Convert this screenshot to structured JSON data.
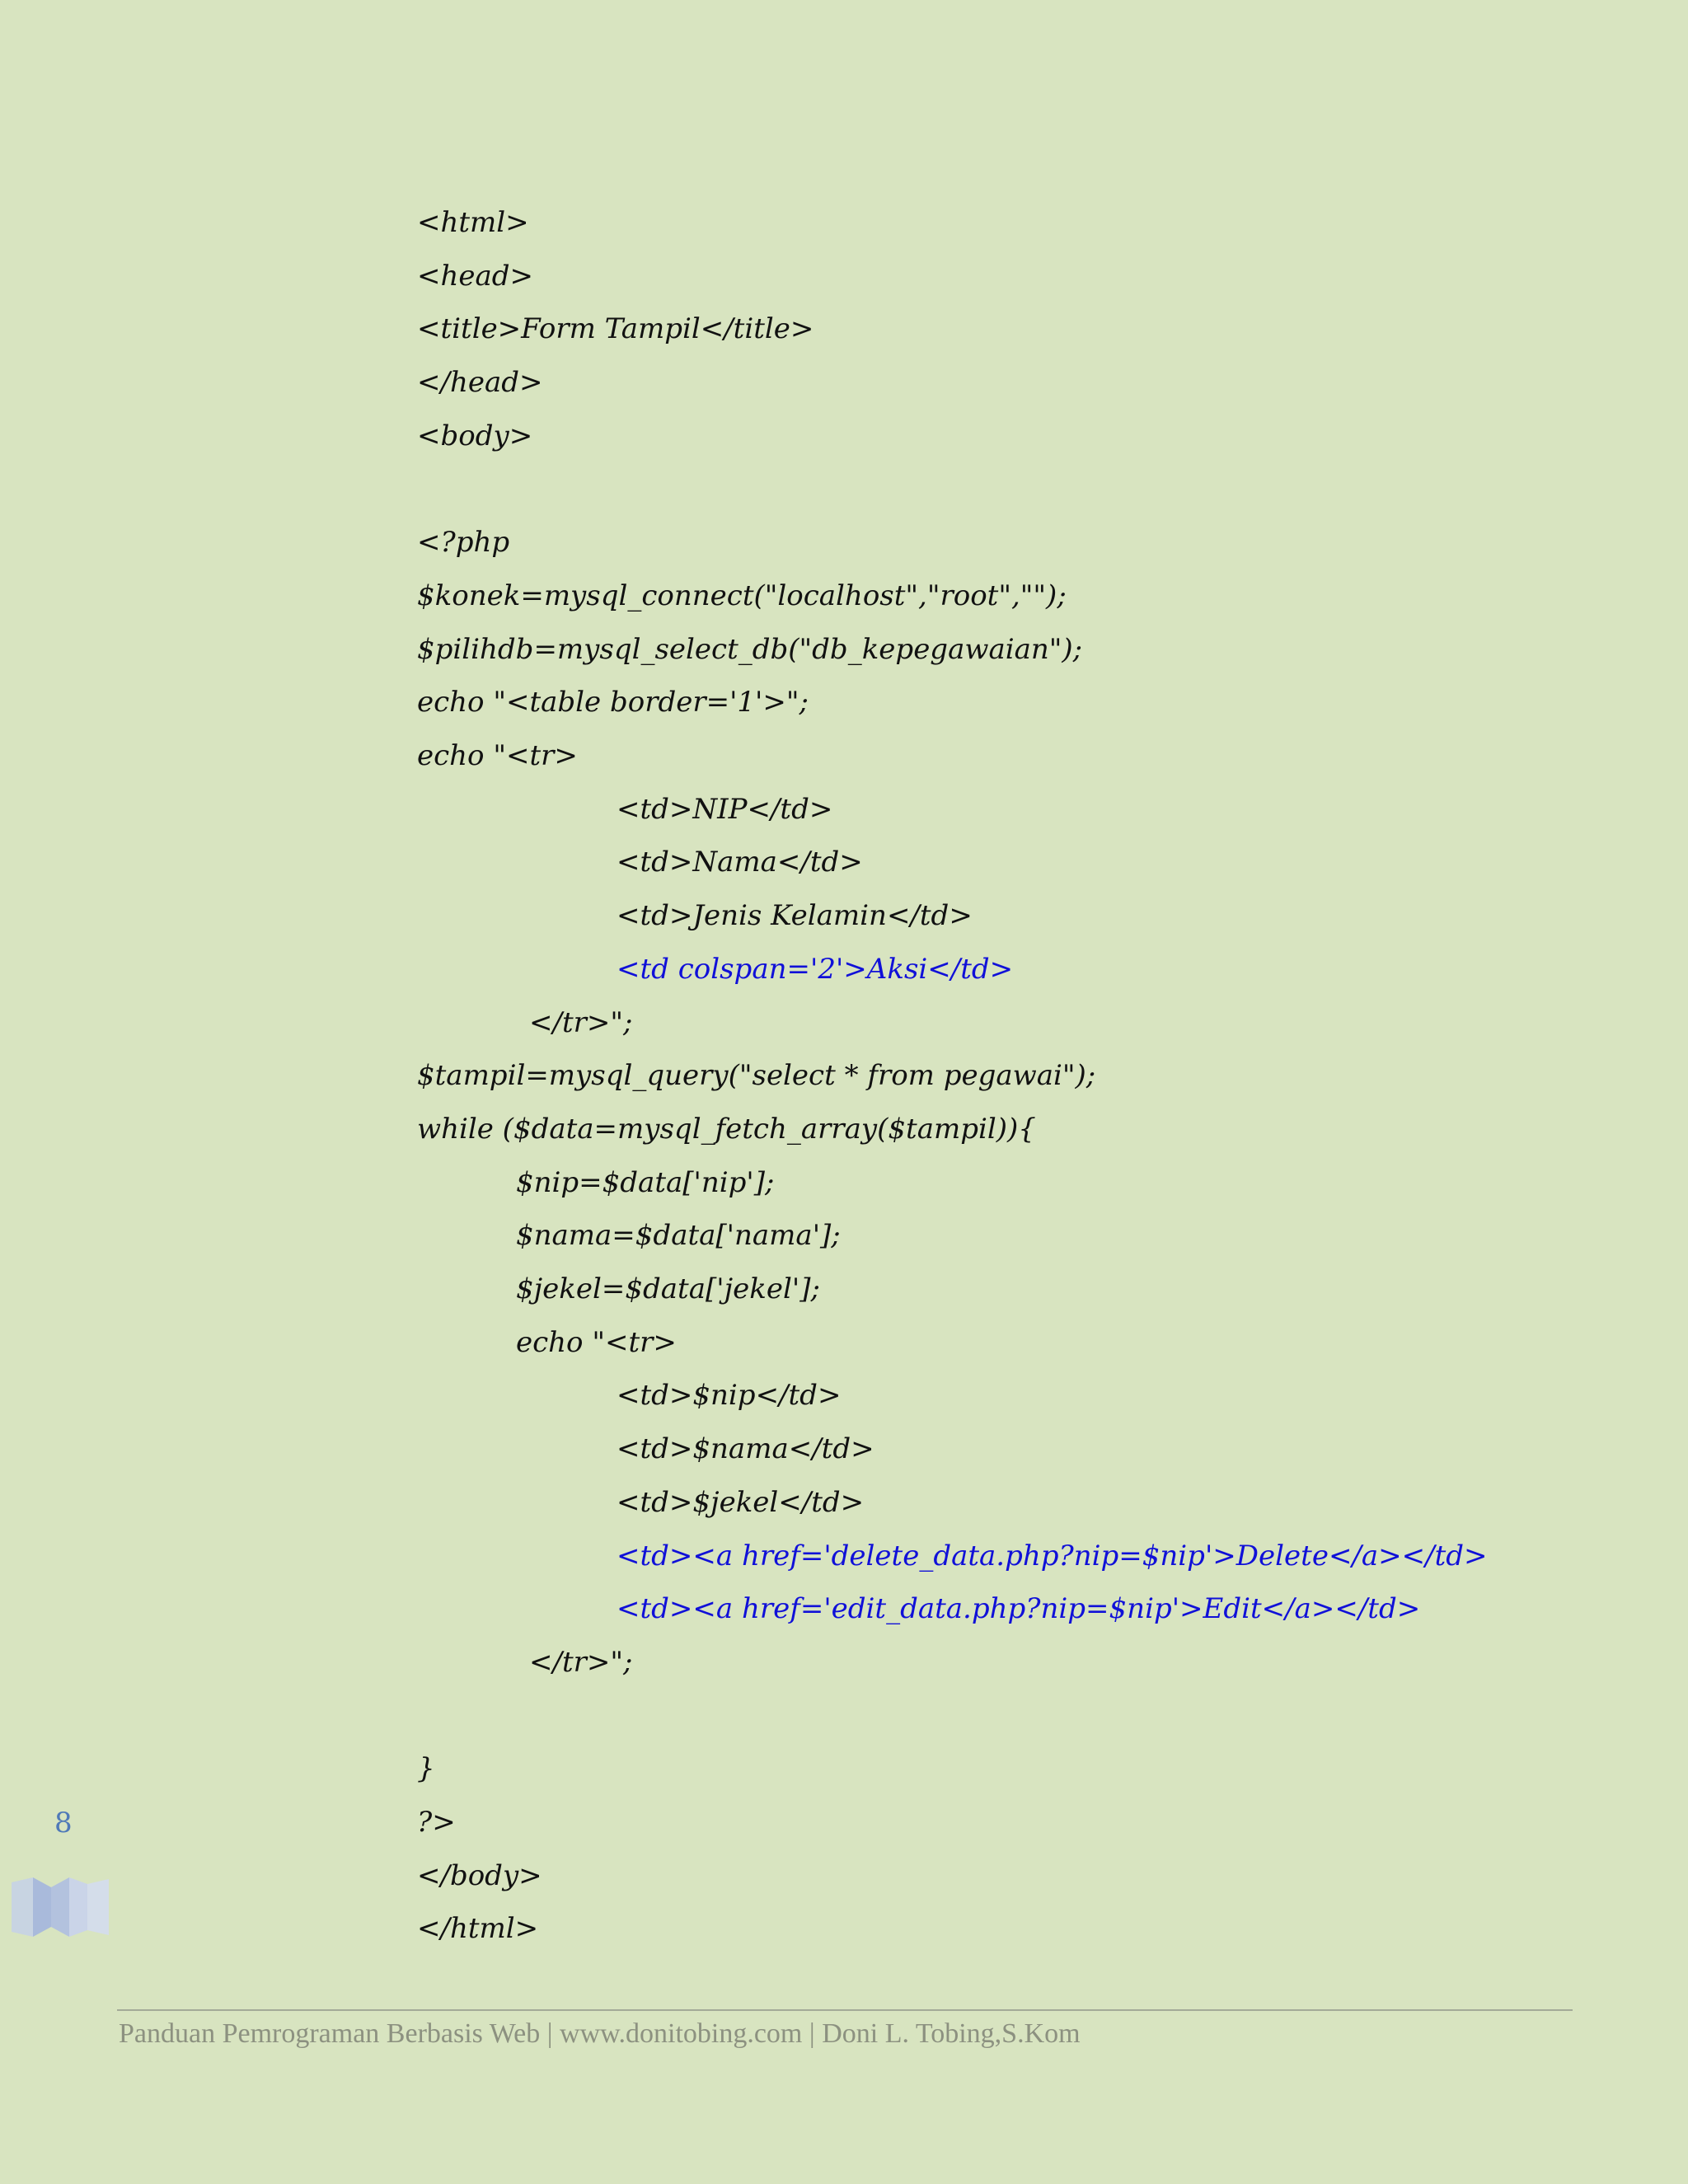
{
  "code_lines": [
    {
      "text": "<html>",
      "indent": 0,
      "color": "black"
    },
    {
      "text": "<head>",
      "indent": 0,
      "color": "black"
    },
    {
      "text": "<title>Form Tampil</title>",
      "indent": 0,
      "color": "black"
    },
    {
      "text": "</head>",
      "indent": 0,
      "color": "black"
    },
    {
      "text": "<body>",
      "indent": 0,
      "color": "black"
    },
    {
      "text": "",
      "indent": 0,
      "color": "black"
    },
    {
      "text": "<?php",
      "indent": 0,
      "color": "black"
    },
    {
      "text": "$konek=mysql_connect(\"localhost\",\"root\",\"\");",
      "indent": 0,
      "color": "black"
    },
    {
      "text": "$pilihdb=mysql_select_db(\"db_kepegawaian\");",
      "indent": 0,
      "color": "black"
    },
    {
      "text": "echo \"<table border='1'>\";",
      "indent": 0,
      "color": "black"
    },
    {
      "text": "echo \"<tr>",
      "indent": 0,
      "color": "black"
    },
    {
      "text": "<td>NIP</td>",
      "indent": 2,
      "color": "black"
    },
    {
      "text": "<td>Nama</td>",
      "indent": 2,
      "color": "black"
    },
    {
      "text": "<td>Jenis Kelamin</td>",
      "indent": 2,
      "color": "black"
    },
    {
      "text": "<td colspan='2'>Aksi</td>",
      "indent": 2,
      "color": "blue"
    },
    {
      "text": "</tr>\";",
      "indent": 1,
      "color": "black"
    },
    {
      "text": "$tampil=mysql_query(\"select * from pegawai\");",
      "indent": 0,
      "color": "black"
    },
    {
      "text": "while ($data=mysql_fetch_array($tampil)){",
      "indent": 0,
      "color": "black"
    },
    {
      "text": "$nip=$data['nip'];",
      "indent": 1,
      "color": "black"
    },
    {
      "text": "$nama=$data['nama'];",
      "indent": 1,
      "color": "black"
    },
    {
      "text": "$jekel=$data['jekel'];",
      "indent": 1,
      "color": "black"
    },
    {
      "text": "echo \"<tr>",
      "indent": 1,
      "color": "black"
    },
    {
      "text": "<td>$nip</td>",
      "indent": 2,
      "color": "black"
    },
    {
      "text": "<td>$nama</td>",
      "indent": 2,
      "color": "black"
    },
    {
      "text": "<td>$jekel</td>",
      "indent": 2,
      "color": "black"
    },
    {
      "text": "<td><a href='delete_data.php?nip=$nip'>Delete</a></td>",
      "indent": 2,
      "color": "blue"
    },
    {
      "text": "<td><a href='edit_data.php?nip=$nip'>Edit</a></td>",
      "indent": 2,
      "color": "blue"
    },
    {
      "text": "</tr>\";",
      "indent": 1,
      "color": "black"
    },
    {
      "text": "",
      "indent": 0,
      "color": "black"
    },
    {
      "text": "}",
      "indent": 0,
      "color": "black"
    },
    {
      "text": "?>",
      "indent": 0,
      "color": "black"
    },
    {
      "text": "</body>",
      "indent": 0,
      "color": "black"
    },
    {
      "text": "</html>",
      "indent": 0,
      "color": "black"
    }
  ],
  "page_number": "8",
  "footer": {
    "text": "Panduan Pemrograman Berbasis Web | www.donitobing.com | Doni L. Tobing,S.Kom"
  },
  "colors": {
    "page_background": "#d8e4c0",
    "code_text": "#111111",
    "code_highlight": "#1010d8",
    "page_number": "#4f79b8",
    "footer_text": "#8c9180"
  }
}
